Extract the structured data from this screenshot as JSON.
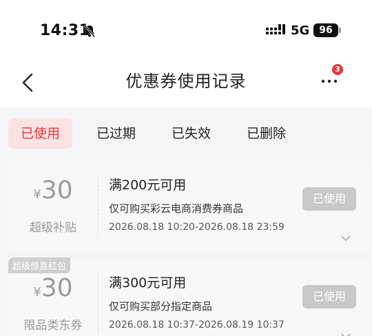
{
  "status_bar": {
    "time": "14:31",
    "network": "5G",
    "battery": "96"
  },
  "nav": {
    "title": "优惠券使用记录",
    "badge_count": "3"
  },
  "tabs": [
    {
      "label": "已使用",
      "active": true
    },
    {
      "label": "已过期",
      "active": false
    },
    {
      "label": "已失效",
      "active": false
    },
    {
      "label": "已删除",
      "active": false
    }
  ],
  "coupons": [
    {
      "tag": "",
      "currency": "¥",
      "amount": "30",
      "type": "超级补贴",
      "condition": "满200元可用",
      "scope": "仅可购买彩云电商消费券商品",
      "period": "2026.08.18 10:20-2026.08.18 23:59",
      "status": "已使用"
    },
    {
      "tag": "超级惊喜红包",
      "currency": "¥",
      "amount": "30",
      "type": "限品类东券",
      "condition": "满300元可用",
      "scope": "仅可购买部分指定商品",
      "period": "2026.08.18 10:37-2026.08.19 10:37",
      "status": "已使用"
    }
  ],
  "colors": {
    "accent": "#e4393c",
    "active_tab_bg": "#fbe3e4",
    "disabled_button": "#c9c9c9",
    "muted_text": "#9a9a9a"
  }
}
